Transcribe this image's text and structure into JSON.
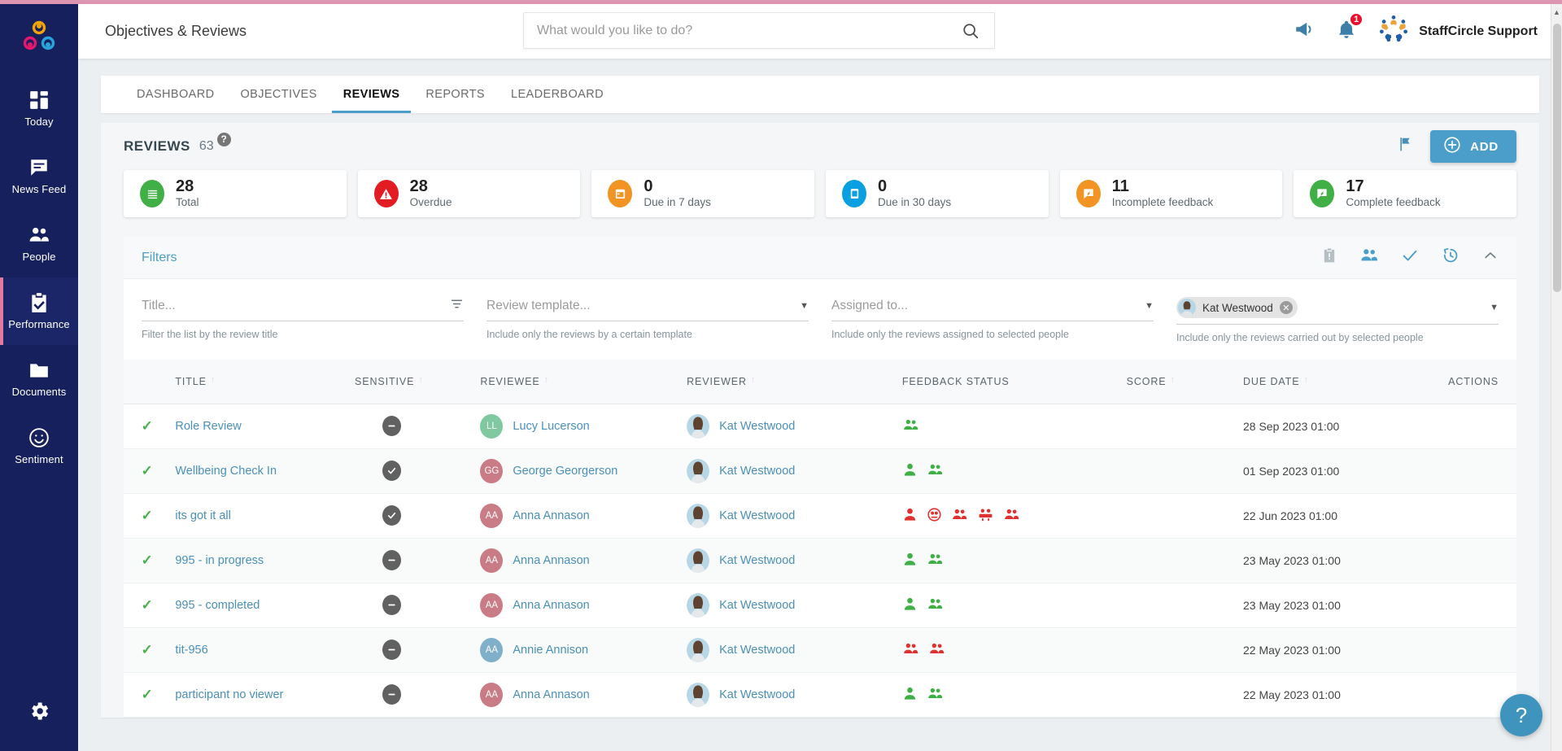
{
  "accent": {
    "pink": "#dd96b2",
    "blue": "#4a9ec9",
    "navy": "#16205c",
    "green": "#3faf46",
    "red": "#e03131",
    "orange": "#f29423"
  },
  "header": {
    "page_title": "Objectives & Reviews",
    "search": {
      "placeholder": "What would you like to do?",
      "value": ""
    },
    "org_name": "StaffCircle Support",
    "notification_count": "1"
  },
  "sidebar": {
    "items": [
      {
        "label": "Today",
        "icon": "grid-icon",
        "active": false
      },
      {
        "label": "News Feed",
        "icon": "chat-icon",
        "active": false
      },
      {
        "label": "People",
        "icon": "people-icon",
        "active": false
      },
      {
        "label": "Performance",
        "icon": "clipboard-check-icon",
        "active": true
      },
      {
        "label": "Documents",
        "icon": "folder-icon",
        "active": false
      },
      {
        "label": "Sentiment",
        "icon": "smiley-icon",
        "active": false
      }
    ],
    "settings_label": "Settings"
  },
  "tabs": [
    {
      "label": "DASHBOARD",
      "active": false
    },
    {
      "label": "OBJECTIVES",
      "active": false
    },
    {
      "label": "REVIEWS",
      "active": true
    },
    {
      "label": "REPORTS",
      "active": false
    },
    {
      "label": "LEADERBOARD",
      "active": false
    }
  ],
  "panel": {
    "title": "REVIEWS",
    "count": "63",
    "help_glyph": "?",
    "add_label": "ADD"
  },
  "stats": [
    {
      "value": "28",
      "label": "Total",
      "color": "#3faf46",
      "icon": "list-icon"
    },
    {
      "value": "28",
      "label": "Overdue",
      "color": "#e31b23",
      "icon": "warning-icon"
    },
    {
      "value": "0",
      "label": "Due in 7 days",
      "color": "#f29423",
      "icon": "calendar-icon"
    },
    {
      "value": "0",
      "label": "Due in 30 days",
      "color": "#0a9fe0",
      "icon": "document-icon"
    },
    {
      "value": "11",
      "label": "Incomplete feedback",
      "color": "#f29423",
      "icon": "feedback-icon"
    },
    {
      "value": "17",
      "label": "Complete feedback",
      "color": "#3faf46",
      "icon": "feedback-icon"
    }
  ],
  "filters": {
    "title": "Filters",
    "fields": [
      {
        "name": "title",
        "placeholder": "Title...",
        "help": "Filter the list by the review title",
        "trailing": "filter-icon"
      },
      {
        "name": "template",
        "placeholder": "Review template...",
        "help": "Include only the reviews by a certain template",
        "trailing": "chevron-down-icon"
      },
      {
        "name": "assigned",
        "placeholder": "Assigned to...",
        "help": "Include only the reviews assigned to selected people",
        "trailing": "chevron-down-icon"
      },
      {
        "name": "reviewer",
        "placeholder": "",
        "help": "Include only the reviews carried out by selected people",
        "trailing": "chevron-down-icon",
        "chip": "Kat Westwood"
      }
    ],
    "tools": [
      "clipboard-alert-icon",
      "people-icon",
      "check-icon",
      "history-icon",
      "chevron-up-icon"
    ]
  },
  "table": {
    "columns": [
      {
        "key": "check",
        "label": "",
        "sortable": false
      },
      {
        "key": "title",
        "label": "TITLE",
        "sortable": true
      },
      {
        "key": "sensitive",
        "label": "SENSITIVE",
        "sortable": true
      },
      {
        "key": "reviewee",
        "label": "REVIEWEE",
        "sortable": true
      },
      {
        "key": "reviewer",
        "label": "REVIEWER",
        "sortable": true
      },
      {
        "key": "feedback",
        "label": "FEEDBACK STATUS",
        "sortable": false
      },
      {
        "key": "score",
        "label": "SCORE",
        "sortable": true
      },
      {
        "key": "due",
        "label": "DUE DATE",
        "sortable": true
      },
      {
        "key": "actions",
        "label": "ACTIONS",
        "sortable": false
      }
    ],
    "rows": [
      {
        "title": "Role Review",
        "sensitive": "minus",
        "reviewee": {
          "name": "Lucy Lucerson",
          "initials": "LL",
          "color": "#7fc8a0"
        },
        "reviewer": {
          "name": "Kat Westwood",
          "photo": true
        },
        "feedback": [
          {
            "icon": "people-icon",
            "color": "#3faf46"
          }
        ],
        "score_filled": false,
        "due": "28 Sep 2023 01:00"
      },
      {
        "title": "Wellbeing Check In",
        "sensitive": "check",
        "reviewee": {
          "name": "George Georgerson",
          "initials": "GG",
          "color": "#c97b86"
        },
        "reviewer": {
          "name": "Kat Westwood",
          "photo": true
        },
        "feedback": [
          {
            "icon": "person-icon",
            "color": "#3faf46"
          },
          {
            "icon": "people-icon",
            "color": "#3faf46"
          }
        ],
        "score_filled": false,
        "due": "01 Sep 2023 01:00"
      },
      {
        "title": "its got it all",
        "sensitive": "check",
        "reviewee": {
          "name": "Anna Annason",
          "initials": "AA",
          "color": "#c97b86"
        },
        "reviewer": {
          "name": "Kat Westwood",
          "photo": true
        },
        "feedback": [
          {
            "icon": "person-icon",
            "color": "#e03131"
          },
          {
            "icon": "head-icon",
            "color": "#e03131"
          },
          {
            "icon": "people-icon",
            "color": "#e03131"
          },
          {
            "icon": "group-icon",
            "color": "#e03131"
          },
          {
            "icon": "people-icon",
            "color": "#e03131"
          }
        ],
        "score_filled": false,
        "due": "22 Jun 2023 01:00"
      },
      {
        "title": "995 - in progress",
        "sensitive": "minus",
        "reviewee": {
          "name": "Anna Annason",
          "initials": "AA",
          "color": "#c97b86"
        },
        "reviewer": {
          "name": "Kat Westwood",
          "photo": true
        },
        "feedback": [
          {
            "icon": "person-icon",
            "color": "#3faf46"
          },
          {
            "icon": "people-icon",
            "color": "#3faf46"
          }
        ],
        "score_filled": true,
        "due": "23 May 2023 01:00"
      },
      {
        "title": "995 - completed",
        "sensitive": "minus",
        "reviewee": {
          "name": "Anna Annason",
          "initials": "AA",
          "color": "#c97b86"
        },
        "reviewer": {
          "name": "Kat Westwood",
          "photo": true
        },
        "feedback": [
          {
            "icon": "person-icon",
            "color": "#3faf46"
          },
          {
            "icon": "people-icon",
            "color": "#3faf46"
          }
        ],
        "score_filled": true,
        "due": "23 May 2023 01:00"
      },
      {
        "title": "tit-956",
        "sensitive": "minus",
        "reviewee": {
          "name": "Annie Annison",
          "initials": "AA",
          "color": "#7fafc9"
        },
        "reviewer": {
          "name": "Kat Westwood",
          "photo": true
        },
        "feedback": [
          {
            "icon": "people-icon",
            "color": "#e03131"
          },
          {
            "icon": "people-icon",
            "color": "#e03131"
          }
        ],
        "score_filled": false,
        "due": "22 May 2023 01:00"
      },
      {
        "title": "participant no viewer",
        "sensitive": "minus",
        "reviewee": {
          "name": "Anna Annason",
          "initials": "AA",
          "color": "#c97b86"
        },
        "reviewer": {
          "name": "Kat Westwood",
          "photo": true
        },
        "feedback": [
          {
            "icon": "person-icon",
            "color": "#3faf46"
          },
          {
            "icon": "people-icon",
            "color": "#3faf46"
          }
        ],
        "score_filled": true,
        "due": "22 May 2023 01:00"
      }
    ]
  },
  "help_fab": {
    "glyph": "?"
  }
}
